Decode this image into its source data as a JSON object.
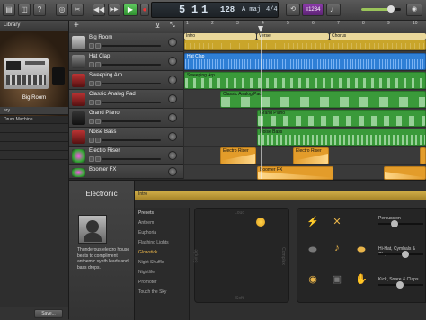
{
  "toolbar": {
    "rewind_icon": "rewind-icon",
    "forward_icon": "fast-forward-icon",
    "play_icon": "play-icon",
    "record_icon": "record-icon",
    "lcd": {
      "bar": "5",
      "beat": "1",
      "division": "1",
      "tempo": "128",
      "key": "A maj",
      "signature": "4/4"
    },
    "count_in": "≡1234",
    "tuner_icon": "tuner-icon",
    "master_volume": 0.7
  },
  "library": {
    "title": "Library",
    "patch_name": "Big Room",
    "category": "Drum Machine",
    "save_label": "Save..."
  },
  "tracks": [
    {
      "name": "Big Room",
      "color": "#c9a52a",
      "icon": "drum-machine-icon"
    },
    {
      "name": "Hat Clap",
      "color": "#2f7fd6",
      "icon": "hihat-icon"
    },
    {
      "name": "Sweeping Arp",
      "color": "#3a9a3a",
      "icon": "synth-icon"
    },
    {
      "name": "Classic Analog Pad",
      "color": "#3a9a3a",
      "icon": "synth-icon"
    },
    {
      "name": "Grand Piano",
      "color": "#3a9a3a",
      "icon": "piano-icon"
    },
    {
      "name": "Noise Bass",
      "color": "#3a9a3a",
      "icon": "synth-icon"
    },
    {
      "name": "Electro Riser",
      "color": "#e39c2a",
      "icon": "sparkle-icon"
    },
    {
      "name": "Boomer FX",
      "color": "#e39c2a",
      "icon": "sparkle-icon"
    }
  ],
  "arrangement": {
    "markers": [
      "Intro",
      "Verse",
      "Chorus"
    ],
    "regions": {
      "hat_clap": "Hat Clap",
      "sweeping_arp": "Sweeping Arp",
      "classic_analog_pad": "Classic Analog Pad",
      "grand_piano": "Grand Piano",
      "noise_bass": "Noise Bass",
      "electro_riser_1": "Electro Riser",
      "electro_riser_2": "Electro Riser",
      "boomer_fx": "Boomer FX"
    }
  },
  "editor": {
    "genre": "Electronic",
    "description": "Thunderous electro house beats to compliment anthemic synth leads and bass drops.",
    "region_label": "Intro",
    "presets_header": "Presets",
    "presets": [
      "Anthem",
      "Euphoria",
      "Flashing Lights",
      "Glowstick",
      "Night Shuffle",
      "Nightlife",
      "Promoter",
      "Touch the Sky"
    ],
    "selected_preset": "Glowstick",
    "pad_labels": {
      "top": "Loud",
      "bottom": "Soft",
      "left": "Simple",
      "right": "Complex"
    },
    "instrument_groups": [
      "Percussion",
      "Hi-Hat, Cymbals & Claps",
      "Kick, Snare & Claps"
    ],
    "accent_color": "#e8b44a"
  }
}
